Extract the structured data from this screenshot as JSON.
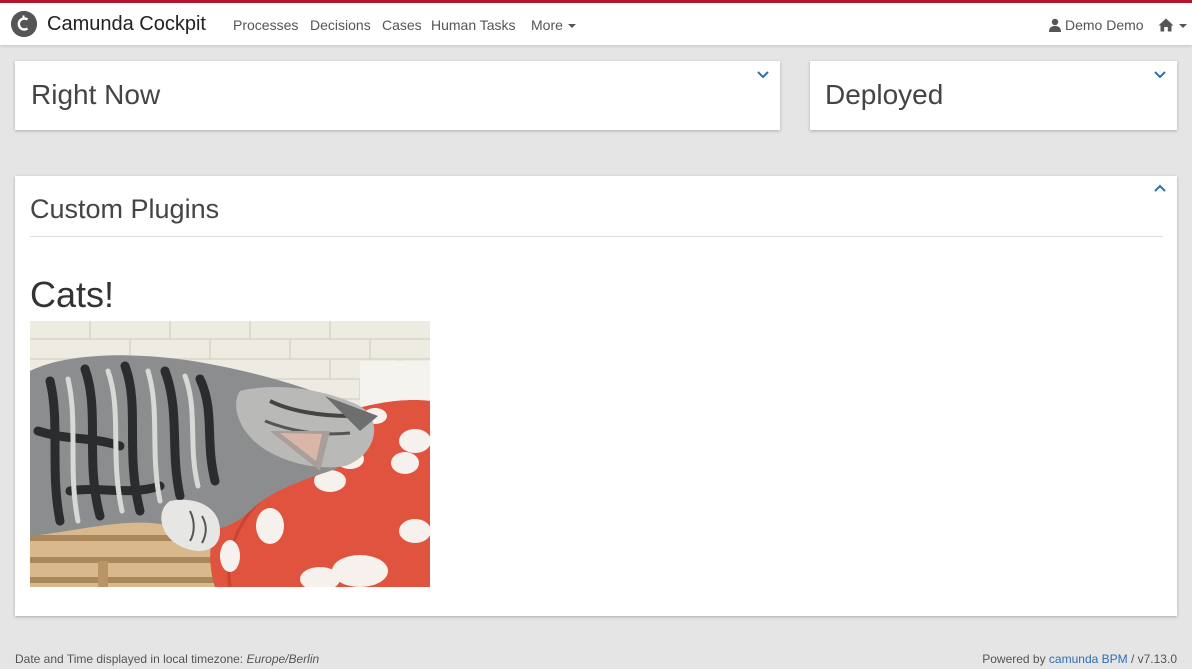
{
  "app": {
    "brand_name": "Camunda Cockpit",
    "accent_color": "#b5152b",
    "link_color": "#2c6fb3"
  },
  "nav": {
    "items": [
      {
        "label": "Processes"
      },
      {
        "label": "Decisions"
      },
      {
        "label": "Cases"
      },
      {
        "label": "Human Tasks"
      },
      {
        "label": "More"
      }
    ],
    "user_label": "Demo Demo",
    "home_icon": "home-icon"
  },
  "dashboard": {
    "right_now": {
      "title": "Right Now",
      "toggle_icon": "chevron-down-icon"
    },
    "deployed": {
      "title": "Deployed",
      "toggle_icon": "chevron-down-icon"
    },
    "custom_plugins": {
      "title": "Custom Plugins",
      "toggle_icon": "chevron-up-icon",
      "heading": "Cats!",
      "image_alt": "sleeping tabby cat on a red pillow"
    }
  },
  "footer": {
    "timezone_prefix": "Date and Time displayed in local timezone: ",
    "timezone": "Europe/Berlin",
    "powered_prefix": "Powered by ",
    "powered_link": "camunda BPM",
    "version": " / v7.13.0"
  }
}
